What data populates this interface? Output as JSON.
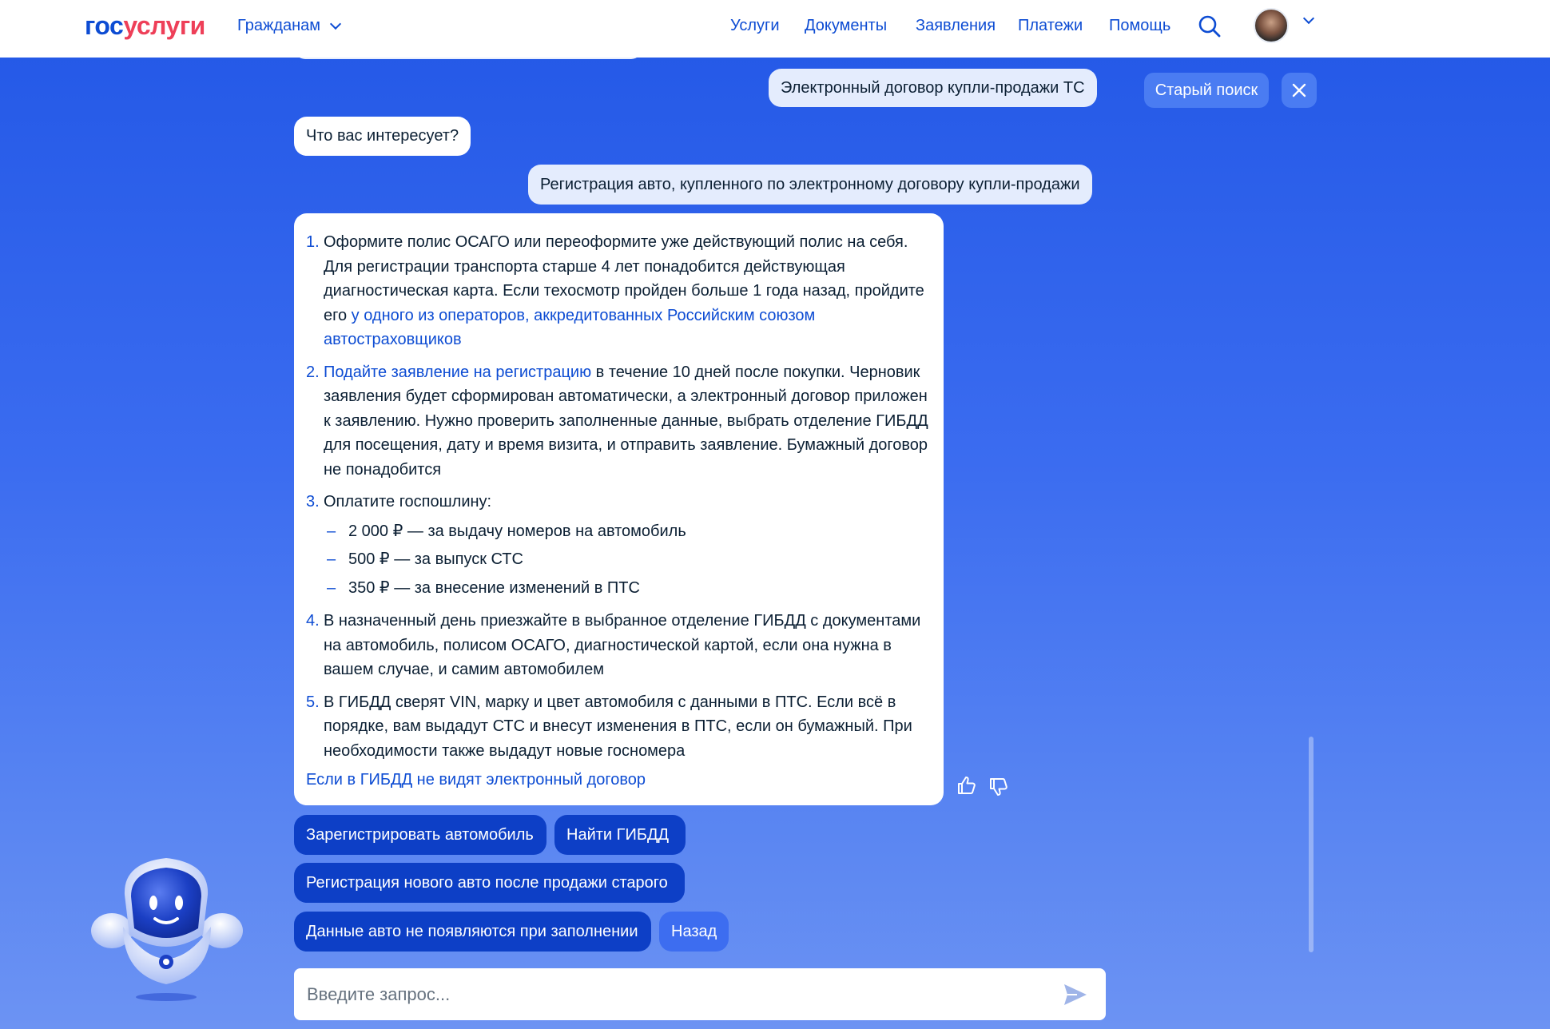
{
  "header": {
    "logo_part1": "гос",
    "logo_part2": "услуги",
    "audience": "Гражданам",
    "nav": [
      "Услуги",
      "Документы",
      "Заявления",
      "Платежи",
      "Помощь"
    ]
  },
  "chat": {
    "user_message_1": "Электронный договор купли-продажи ТС",
    "bot_question": "Что вас интересует?",
    "user_message_2": "Регистрация авто, купленного по электронному договору купли-продажи",
    "old_search": "Старый поиск",
    "answer": {
      "steps": [
        {
          "num": "1.",
          "text": "Оформите полис ОСАГО или переоформите уже действующий полис на себя. Для регистрации транспорта старше 4 лет понадобится действующая диагностическая карта. Если техосмотр пройден больше 1 года назад, пройдите его ",
          "link": "у одного из операторов, аккредитованных Российским союзом автостраховщиков"
        },
        {
          "num": "2.",
          "link": "Подайте заявление на регистрацию",
          "text": " в течение 10 дней после покупки. Черновик заявления будет сформирован автоматически, а электронный договор приложен к заявлению. Нужно проверить заполненные данные, выбрать отделение ГИБДД для посещения, дату и время визита, и отправить заявление. Бумажный договор не понадобится"
        },
        {
          "num": "3.",
          "text": "Оплатите госпошлину:"
        },
        {
          "num": "4.",
          "text": "В назначенный день приезжайте в выбранное отделение ГИБДД с документами на автомобиль, полисом ОСАГО, диагностической картой, если она нужна в вашем случае, и самим автомобилем"
        },
        {
          "num": "5.",
          "text": "В ГИБДД сверят VIN, марку и цвет автомобиля с данными в ПТС. Если всё в порядке, вам выдадут СТС и внесут изменения в ПТС, если он бумажный. При необходимости также выдадут новые госномера"
        }
      ],
      "fees": [
        "2 000 ₽ — за выдачу номеров на автомобиль",
        "500 ₽ — за выпуск СТС",
        "350 ₽ — за внесение изменений в ПТС"
      ],
      "footer_link": "Если в ГИБДД не видят электронный договор"
    },
    "chips": {
      "register_car": "Зарегистрировать автомобиль",
      "find_gibdd": "Найти ГИБДД",
      "new_car_after_sale": "Регистрация нового авто после продажи старого",
      "data_not_appearing": "Данные авто не появляются при заполнении",
      "back": "Назад"
    },
    "input": {
      "placeholder": "Введите запрос..."
    }
  },
  "colors": {
    "brand_blue": "#0d4cd3",
    "brand_red": "#ee3f58",
    "chip_dark": "#0d3fc6",
    "chip_light": "#3d6df0",
    "user_bubble": "#e4ecfd"
  },
  "icons": [
    "chevron-down-icon",
    "search-icon",
    "avatar",
    "close-icon",
    "thumbs-up-icon",
    "thumbs-down-icon",
    "send-icon",
    "robot-mascot"
  ]
}
